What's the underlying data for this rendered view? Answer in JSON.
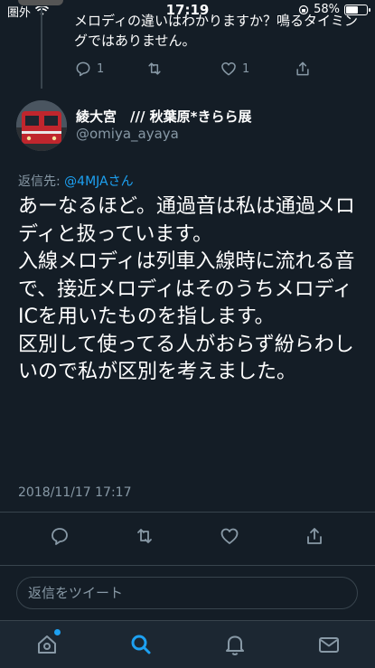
{
  "status_bar": {
    "carrier": "圏外",
    "time": "17:19",
    "battery_percent": "58%",
    "battery_level": 0.58
  },
  "previous_tweet": {
    "text": "メロディの違いはわかりますか？鳴るタイミングではありません。",
    "reply_count": "1",
    "like_count": "1"
  },
  "tweet": {
    "display_name": "綾大宮　/// 秋葉原*きらら展",
    "handle": "@omiya_ayaya",
    "reply_prefix": "返信先: ",
    "reply_mention": "@4MJAさん",
    "body": "あーなるほど。通過音は私は通過メロディと扱っています。\n入線メロディは列車入線時に流れる音で、接近メロディはそのうちメロディICを用いたものを指します。\n区別して使ってる人がおらず紛らわしいので私が区別を考えました。",
    "timestamp": "2018/11/17 17:17"
  },
  "reply_box": {
    "placeholder": "返信をツイート"
  },
  "icons": {
    "reply": "reply-icon",
    "retweet": "retweet-icon",
    "like": "heart-icon",
    "share": "share-icon",
    "home": "home-icon",
    "search": "search-icon",
    "notifications": "bell-icon",
    "messages": "mail-icon"
  },
  "colors": {
    "background": "#141d26",
    "accent": "#1da1f2",
    "secondary_text": "#8899a6",
    "divider": "#38444d"
  }
}
